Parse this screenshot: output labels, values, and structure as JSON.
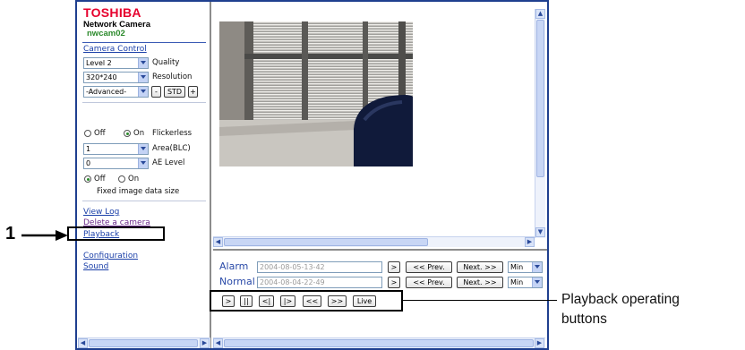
{
  "header": {
    "logo": "TOSHIBA",
    "product": "Network Camera",
    "camera_name": "nwcam02"
  },
  "camera_control": {
    "title": "Camera Control",
    "quality": {
      "value": "Level 2",
      "label": "Quality"
    },
    "resolution": {
      "value": "320*240",
      "label": "Resolution"
    },
    "advanced": {
      "value": "-Advanced-",
      "minus": "-",
      "std": "STD",
      "plus": "+"
    },
    "flicker": {
      "off": "Off",
      "on": "On",
      "label": "Flickerless"
    },
    "area": {
      "value": "1",
      "label": "Area(BLC)"
    },
    "ae": {
      "value": "0",
      "label": "AE Level"
    },
    "fixed": {
      "off": "Off",
      "on": "On",
      "label": "Fixed image data size"
    }
  },
  "links": {
    "view_log": "View Log",
    "delete_camera": "Delete a camera",
    "playback": "Playback",
    "configuration": "Configuration",
    "sound": "Sound"
  },
  "playback": {
    "alarm_label": "Alarm",
    "alarm_value": "2004-08-05-13-42",
    "normal_label": "Normal",
    "normal_value": "2004-08-04-22-49",
    "go": ">",
    "prev": "<< Prev.",
    "next": "Next. >>",
    "unit": "Min",
    "controls": [
      ">",
      "||",
      "<|",
      "|>",
      "<<",
      ">>",
      "Live"
    ]
  },
  "annotations": {
    "number": "1",
    "callout_line1": "Playback operating",
    "callout_line2": "buttons"
  }
}
